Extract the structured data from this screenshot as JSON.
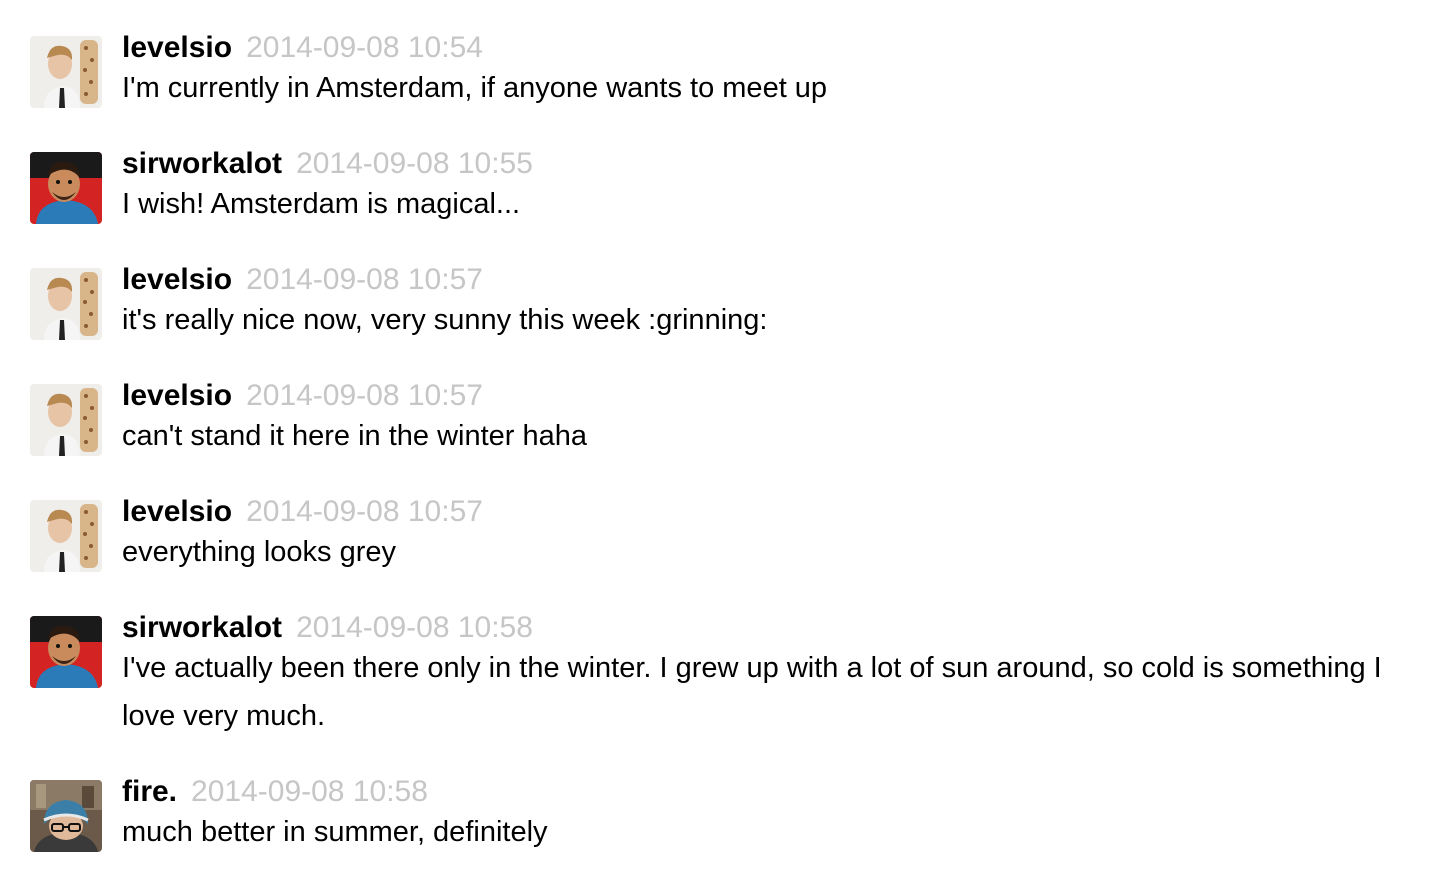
{
  "colors": {
    "background": "#ffffff",
    "author": "#000000",
    "timestamp": "#c6c6c6",
    "text": "#000000"
  },
  "messages": [
    {
      "author": "levelsio",
      "avatar": "levelsio-avatar",
      "time": "2014-09-08 10:54",
      "text": "I'm currently in Amsterdam, if anyone wants to meet up"
    },
    {
      "author": "sirworkalot",
      "avatar": "sirworkalot-avatar",
      "time": "2014-09-08 10:55",
      "text": "I wish! Amsterdam is magical..."
    },
    {
      "author": "levelsio",
      "avatar": "levelsio-avatar",
      "time": "2014-09-08 10:57",
      "text": "it's really nice now, very sunny this week :grinning:"
    },
    {
      "author": "levelsio",
      "avatar": "levelsio-avatar",
      "time": "2014-09-08 10:57",
      "text": "can't stand it here in the winter haha"
    },
    {
      "author": "levelsio",
      "avatar": "levelsio-avatar",
      "time": "2014-09-08 10:57",
      "text": "everything looks grey"
    },
    {
      "author": "sirworkalot",
      "avatar": "sirworkalot-avatar",
      "time": "2014-09-08 10:58",
      "text": "I've actually been there only in the winter. I grew up with a lot of sun around, so cold is something I love very much."
    },
    {
      "author": "fire.",
      "avatar": "fire-avatar",
      "time": "2014-09-08 10:58",
      "text": "much better in summer, definitely"
    }
  ]
}
